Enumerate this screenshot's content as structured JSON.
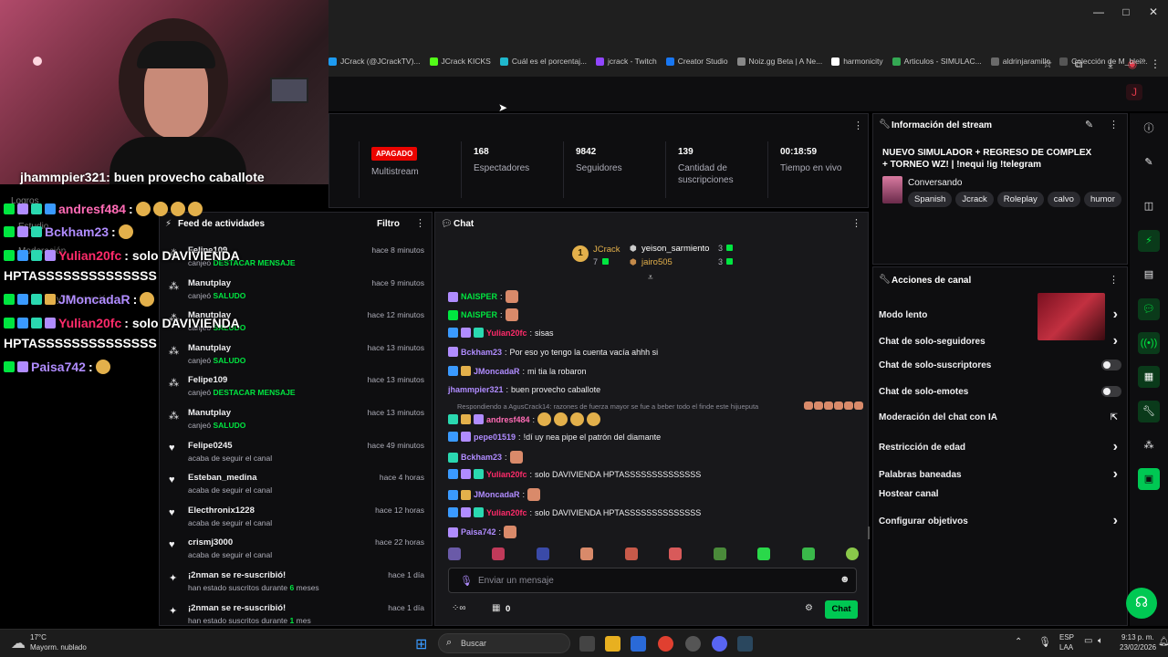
{
  "bookmarks": [
    {
      "label": "JCrack (@JCrackTV)...",
      "color": "#1d9bf0"
    },
    {
      "label": "JCrack KICKS",
      "color": "#53fc18"
    },
    {
      "label": "Cuál es el porcentaj...",
      "color": "#20b8cd"
    },
    {
      "label": "jcrack - Twitch",
      "color": "#9146ff"
    },
    {
      "label": "Creator Studio",
      "color": "#1877f2"
    },
    {
      "label": "Noiz.gg Beta | A Ne...",
      "color": "#888888"
    },
    {
      "label": "harmonicity",
      "color": "#ffffff"
    },
    {
      "label": "Articulos - SIMULAC...",
      "color": "#34a853"
    },
    {
      "label": "aldrinjaramillo",
      "color": "#6a6a6a"
    },
    {
      "label": "Colección de M_blei...",
      "color": "#555555"
    }
  ],
  "stats": {
    "partial_label": "cio",
    "live_badge": "APAGADO",
    "multistream": "Multistream",
    "viewers": {
      "value": "168",
      "label": "Espectadores"
    },
    "followers": {
      "value": "9842",
      "label": "Seguidores"
    },
    "subs": {
      "value": "139",
      "label": "Cantidad de suscripciones"
    },
    "uptime": {
      "value": "00:18:59",
      "label": "Tiempo en vivo"
    }
  },
  "stream_info": {
    "title": "Información del stream",
    "stream_title": "NUEVO SIMULADOR + REGRESO DE COMPLEX + TORNEO WZ! | !nequi !ig !telegram",
    "category": "Conversando",
    "tags": [
      "Spanish",
      "Jcrack",
      "Roleplay",
      "calvo",
      "humor"
    ]
  },
  "actions": {
    "title": "Acciones de canal",
    "items": [
      {
        "label": "Modo lento",
        "control": "chevron"
      },
      {
        "label": "Chat de solo-seguidores",
        "control": "chevron"
      },
      {
        "label": "Chat de solo-suscriptores",
        "control": "toggle"
      },
      {
        "label": "Chat de solo-emotes",
        "control": "toggle"
      },
      {
        "label": "Moderación del chat con IA",
        "control": "external"
      },
      {
        "label": "Restricción de edad",
        "control": "chevron"
      },
      {
        "label": "Palabras baneadas",
        "control": "chevron"
      },
      {
        "label": "Hostear canal",
        "control": "none"
      },
      {
        "label": "Configurar objetivos",
        "control": "chevron"
      }
    ]
  },
  "feed": {
    "title": "Feed de actividades",
    "filter": "Filtro",
    "items": [
      {
        "name": "Felipe109",
        "desc_prefix": "canjeó",
        "desc_highlight": "DESTACAR MENSAJE",
        "time": "hace 8 minutos",
        "icon": "points-icon"
      },
      {
        "name": "Manutplay",
        "desc_prefix": "canjeó",
        "desc_highlight": "SALUDO",
        "time": "hace 9 minutos",
        "icon": "points-icon"
      },
      {
        "name": "Manutplay",
        "desc_prefix": "canjeó",
        "desc_highlight": "SALUDO",
        "time": "hace 12 minutos",
        "icon": "points-icon"
      },
      {
        "name": "Manutplay",
        "desc_prefix": "canjeó",
        "desc_highlight": "SALUDO",
        "time": "hace 13 minutos",
        "icon": "points-icon"
      },
      {
        "name": "Felipe109",
        "desc_prefix": "canjeó",
        "desc_highlight": "DESTACAR MENSAJE",
        "time": "hace 13 minutos",
        "icon": "points-icon"
      },
      {
        "name": "Manutplay",
        "desc_prefix": "canjeó",
        "desc_highlight": "SALUDO",
        "time": "hace 13 minutos",
        "icon": "points-icon"
      },
      {
        "name": "Felipe0245",
        "desc_prefix": "acaba de seguir el canal",
        "desc_highlight": "",
        "time": "hace 49 minutos",
        "icon": "heart-icon"
      },
      {
        "name": "Esteban_medina",
        "desc_prefix": "acaba de seguir el canal",
        "desc_highlight": "",
        "time": "hace 4 horas",
        "icon": "heart-icon"
      },
      {
        "name": "Electhronix1228",
        "desc_prefix": "acaba de seguir el canal",
        "desc_highlight": "",
        "time": "hace 12 horas",
        "icon": "heart-icon"
      },
      {
        "name": "crismj3000",
        "desc_prefix": "acaba de seguir el canal",
        "desc_highlight": "",
        "time": "hace 22 horas",
        "icon": "heart-icon"
      },
      {
        "name": "¡2nman se re-suscribió!",
        "desc_prefix": "han estado suscritos durante",
        "desc_highlight": "6",
        "desc_suffix": "meses",
        "time": "hace 1 día",
        "icon": "star-icon"
      },
      {
        "name": "¡2nman se re-suscribió!",
        "desc_prefix": "han estado suscritos durante",
        "desc_highlight": "1",
        "desc_suffix": "mes",
        "time": "hace 1 día",
        "icon": "star-icon"
      }
    ]
  },
  "chat": {
    "title": "Chat",
    "leaderboard": {
      "first": {
        "name": "JCrack",
        "count": "7",
        "rank": "1"
      },
      "second": {
        "name": "yeison_sarmiento",
        "count": "3"
      },
      "third": {
        "name": "jairo505",
        "count": "3"
      }
    },
    "reply_context": "Respondiendo a AgusCrack14: razones de fuerza mayor se fue a beber todo el finde este hijueputa",
    "messages": [
      {
        "user": "NAISPER",
        "color": "#00e640",
        "text": "",
        "emote": true
      },
      {
        "user": "NAISPER",
        "color": "#00e640",
        "text": "",
        "emote": true
      },
      {
        "user": "Yulian20fc",
        "color": "#ff2b6a",
        "text": "sisas",
        "emote": false
      },
      {
        "user": "Bckham23",
        "color": "#b08cff",
        "text": "Por eso yo tengo la cuenta vacía ahhh si",
        "emote": false
      },
      {
        "user": "JMoncadaR",
        "color": "#b08cff",
        "text": "mi tia la robaron",
        "emote": false
      },
      {
        "user": "jhammpier321",
        "color": "#b08cff",
        "text": "buen provecho caballote",
        "emote": false
      },
      {
        "user": "andresf484",
        "color": "#ff6bb5",
        "text": "",
        "emote": false,
        "cheers": 4
      },
      {
        "user": "pepe01519",
        "color": "#b08cff",
        "text": "!dí uy nea pipe el patrón del diamante",
        "emote": false
      },
      {
        "user": "Bckham23",
        "color": "#b08cff",
        "text": "",
        "emote": true
      },
      {
        "user": "Yulian20fc",
        "color": "#ff2b6a",
        "text": "solo DAVIVIENDA HPTASSSSSSSSSSSSSS",
        "emote": false
      },
      {
        "user": "JMoncadaR",
        "color": "#b08cff",
        "text": "",
        "emote": true
      },
      {
        "user": "Yulian20fc",
        "color": "#ff2b6a",
        "text": "solo DAVIVIENDA HPTASSSSSSSSSSSSSS",
        "emote": false
      },
      {
        "user": "Paisa742",
        "color": "#b08cff",
        "text": "",
        "emote": true
      }
    ],
    "input_placeholder": "Enviar un mensaje",
    "points": "0",
    "send_label": "Chat"
  },
  "overlay": {
    "lines": [
      {
        "user": "jhammpier321",
        "text": ": buen provecho caballote",
        "color": "#ffffff"
      },
      {
        "user": "andresf484",
        "text": ":",
        "color": "#ff6bb5"
      },
      {
        "user": "Bckham23",
        "text": ":",
        "color": "#b08cff"
      },
      {
        "user": "Yulian20fc",
        "text": ": solo DAVIVIENDA",
        "color": "#ff2b6a"
      },
      {
        "user": "",
        "text": "HPTASSSSSSSSSSSSSS",
        "color": "#ffffff"
      },
      {
        "user": "JMoncadaR",
        "text": ":",
        "color": "#b08cff"
      },
      {
        "user": "Yulian20fc",
        "text": ": solo DAVIVIENDA",
        "color": "#ff2b6a"
      },
      {
        "user": "",
        "text": "HPTASSSSSSSSSSSSSS",
        "color": "#ffffff"
      },
      {
        "user": "Paisa742",
        "text": ":",
        "color": "#b08cff"
      }
    ],
    "faded_labels": [
      "Logros",
      "Estudio",
      "Moderación",
      "y Moneración"
    ]
  },
  "taskbar": {
    "weather_temp": "17°C",
    "weather_desc": "Mayorm. nublado",
    "search_placeholder": "Buscar",
    "lang": "ESP",
    "region": "LAA",
    "time": "9:13 p. m.",
    "date": "23/02/2026"
  }
}
